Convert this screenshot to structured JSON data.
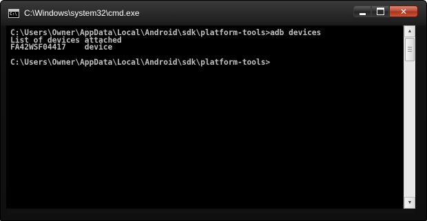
{
  "window": {
    "title": "C:\\Windows\\system32\\cmd.exe",
    "icon": "cmd-icon",
    "icon_text": "C:\\",
    "controls": {
      "minimize_icon": "minimize-icon",
      "maximize_icon": "maximize-icon",
      "close_icon": "close-icon",
      "close_glyph": "✕"
    }
  },
  "console": {
    "lines": [
      "C:\\Users\\Owner\\AppData\\Local\\Android\\sdk\\platform-tools>adb devices",
      "List of devices attached",
      "FA42WSF04417\tdevice",
      "",
      "C:\\Users\\Owner\\AppData\\Local\\Android\\sdk\\platform-tools>"
    ],
    "text_color": "#c0c0c0",
    "background_color": "#000000"
  },
  "scrollbar": {
    "up_arrow": "▲",
    "down_arrow": "▼"
  }
}
